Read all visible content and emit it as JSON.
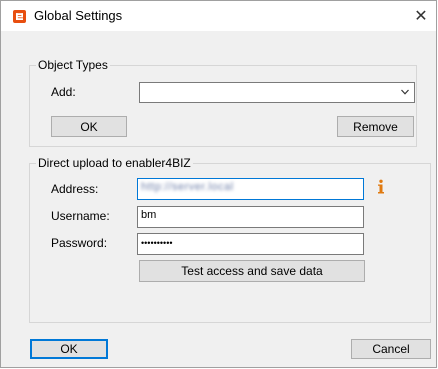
{
  "window": {
    "title": "Global Settings",
    "close_glyph": "✕"
  },
  "object_types": {
    "caption": "Object Types",
    "add_label": "Add:",
    "add_value": "",
    "ok_label": "OK",
    "remove_label": "Remove"
  },
  "direct_upload": {
    "caption": "Direct upload to enabler4BIZ",
    "address_label": "Address:",
    "address_value": "http://server.local",
    "username_label": "Username:",
    "username_value": "bm",
    "password_label": "Password:",
    "password_value": "••••••••••",
    "test_label": "Test access and save data"
  },
  "footer": {
    "ok_label": "OK",
    "cancel_label": "Cancel"
  },
  "colors": {
    "app_icon": "#e84e0f",
    "info_icon": "#e07a10",
    "focus_border": "#0078d7"
  },
  "icons": {
    "app": "enabler-logo-icon",
    "close": "close-icon",
    "dropdown": "chevron-down-icon",
    "info": "info-icon"
  }
}
